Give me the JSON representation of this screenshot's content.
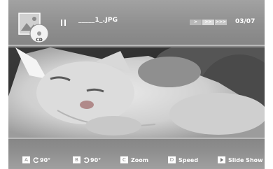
{
  "header": {
    "disc_badge": "CD",
    "file_name": "_____1_.JPG",
    "page_counter": "03/07",
    "speed_indicator": [
      ">",
      ">>",
      ">>>"
    ]
  },
  "footer": {
    "buttons": [
      {
        "key": "A",
        "label": "90°",
        "icon": "rotate-left-icon"
      },
      {
        "key": "B",
        "label": "90°",
        "icon": "rotate-right-icon"
      },
      {
        "key": "C",
        "label": "Zoom"
      },
      {
        "key": "D",
        "label": "Speed"
      },
      {
        "key": "play-icon",
        "label": "Slide Show"
      }
    ]
  },
  "colors": {
    "panel": "#8a8a8a",
    "text": "#ffffff"
  }
}
